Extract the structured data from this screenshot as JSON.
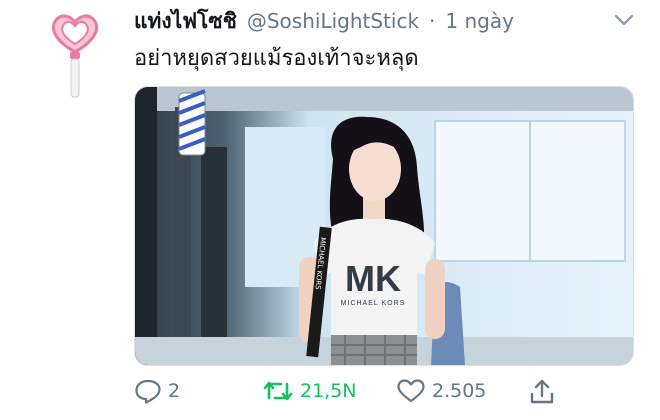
{
  "tweet": {
    "display_name": "แท่งไฟโซชิ",
    "handle": "@SoshiLightStick",
    "separator": "·",
    "time": "1 ngày",
    "text": "อย่าหยุดสวยแม้รองเท้าจะหลุด"
  },
  "media": {
    "shirt_text": "MK",
    "shirt_subtext": "MICHAEL KORS",
    "strap_text": "MICHAEL KORS"
  },
  "actions": {
    "reply_count": "2",
    "retweet_count": "21,5N",
    "like_count": "2.505"
  },
  "colors": {
    "retweet_green": "#17bf63",
    "muted_gray": "#657786",
    "lightstick_pink": "#e97aa3"
  },
  "icons": {
    "avatar": "lightstick-avatar",
    "menu": "chevron-down-icon",
    "reply": "reply-icon",
    "retweet": "retweet-icon",
    "like": "heart-icon",
    "share": "share-icon"
  }
}
